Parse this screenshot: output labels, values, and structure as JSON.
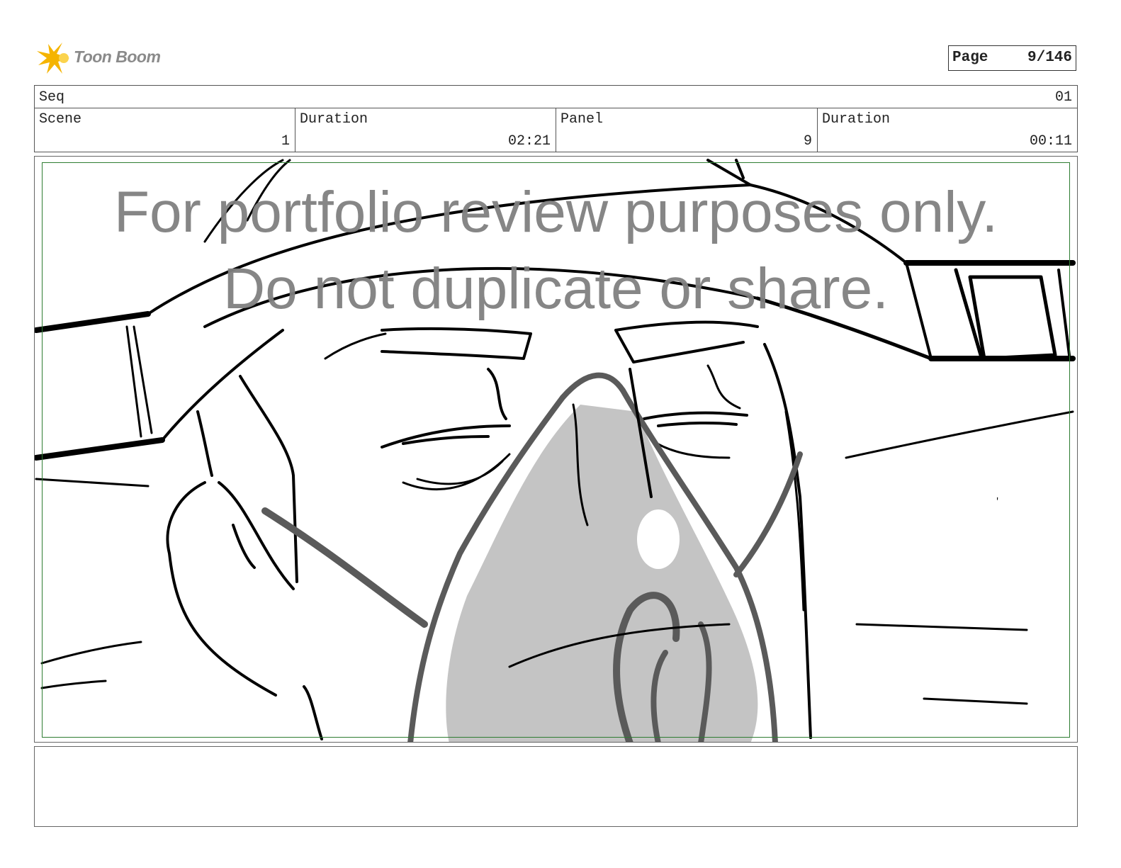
{
  "brand": {
    "name": "Toon Boom",
    "accent": "#f5b400"
  },
  "page": {
    "label": "Page",
    "value": "9/146"
  },
  "header": {
    "seq_label": "Seq",
    "seq_value": "01",
    "scene_label": "Scene",
    "scene_value": "1",
    "scene_duration_label": "Duration",
    "scene_duration_value": "02:21",
    "panel_label": "Panel",
    "panel_value": "9",
    "panel_duration_label": "Duration",
    "panel_duration_value": "00:11"
  },
  "panel": {
    "watermark_line1": "For portfolio review purposes only.",
    "watermark_line2": "Do not duplicate or share.",
    "safe_frame_color": "#2e7d32"
  },
  "notes": {
    "text": ""
  }
}
